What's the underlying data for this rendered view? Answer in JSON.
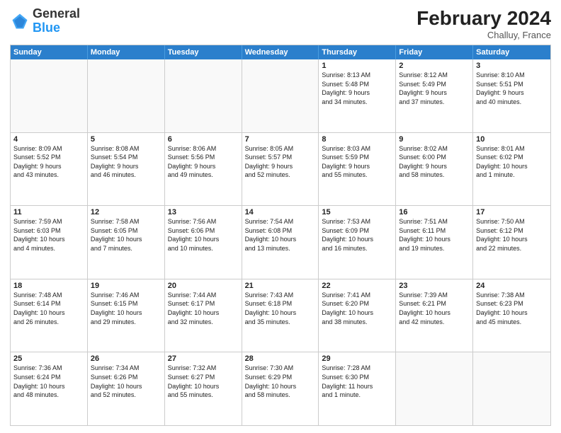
{
  "header": {
    "logo_general": "General",
    "logo_blue": "Blue",
    "month_year": "February 2024",
    "location": "Challuy, France"
  },
  "days_of_week": [
    "Sunday",
    "Monday",
    "Tuesday",
    "Wednesday",
    "Thursday",
    "Friday",
    "Saturday"
  ],
  "rows": [
    [
      {
        "day": "",
        "info": "",
        "empty": true
      },
      {
        "day": "",
        "info": "",
        "empty": true
      },
      {
        "day": "",
        "info": "",
        "empty": true
      },
      {
        "day": "",
        "info": "",
        "empty": true
      },
      {
        "day": "1",
        "info": "Sunrise: 8:13 AM\nSunset: 5:48 PM\nDaylight: 9 hours\nand 34 minutes."
      },
      {
        "day": "2",
        "info": "Sunrise: 8:12 AM\nSunset: 5:49 PM\nDaylight: 9 hours\nand 37 minutes."
      },
      {
        "day": "3",
        "info": "Sunrise: 8:10 AM\nSunset: 5:51 PM\nDaylight: 9 hours\nand 40 minutes."
      }
    ],
    [
      {
        "day": "4",
        "info": "Sunrise: 8:09 AM\nSunset: 5:52 PM\nDaylight: 9 hours\nand 43 minutes."
      },
      {
        "day": "5",
        "info": "Sunrise: 8:08 AM\nSunset: 5:54 PM\nDaylight: 9 hours\nand 46 minutes."
      },
      {
        "day": "6",
        "info": "Sunrise: 8:06 AM\nSunset: 5:56 PM\nDaylight: 9 hours\nand 49 minutes."
      },
      {
        "day": "7",
        "info": "Sunrise: 8:05 AM\nSunset: 5:57 PM\nDaylight: 9 hours\nand 52 minutes."
      },
      {
        "day": "8",
        "info": "Sunrise: 8:03 AM\nSunset: 5:59 PM\nDaylight: 9 hours\nand 55 minutes."
      },
      {
        "day": "9",
        "info": "Sunrise: 8:02 AM\nSunset: 6:00 PM\nDaylight: 9 hours\nand 58 minutes."
      },
      {
        "day": "10",
        "info": "Sunrise: 8:01 AM\nSunset: 6:02 PM\nDaylight: 10 hours\nand 1 minute."
      }
    ],
    [
      {
        "day": "11",
        "info": "Sunrise: 7:59 AM\nSunset: 6:03 PM\nDaylight: 10 hours\nand 4 minutes."
      },
      {
        "day": "12",
        "info": "Sunrise: 7:58 AM\nSunset: 6:05 PM\nDaylight: 10 hours\nand 7 minutes."
      },
      {
        "day": "13",
        "info": "Sunrise: 7:56 AM\nSunset: 6:06 PM\nDaylight: 10 hours\nand 10 minutes."
      },
      {
        "day": "14",
        "info": "Sunrise: 7:54 AM\nSunset: 6:08 PM\nDaylight: 10 hours\nand 13 minutes."
      },
      {
        "day": "15",
        "info": "Sunrise: 7:53 AM\nSunset: 6:09 PM\nDaylight: 10 hours\nand 16 minutes."
      },
      {
        "day": "16",
        "info": "Sunrise: 7:51 AM\nSunset: 6:11 PM\nDaylight: 10 hours\nand 19 minutes."
      },
      {
        "day": "17",
        "info": "Sunrise: 7:50 AM\nSunset: 6:12 PM\nDaylight: 10 hours\nand 22 minutes."
      }
    ],
    [
      {
        "day": "18",
        "info": "Sunrise: 7:48 AM\nSunset: 6:14 PM\nDaylight: 10 hours\nand 26 minutes."
      },
      {
        "day": "19",
        "info": "Sunrise: 7:46 AM\nSunset: 6:15 PM\nDaylight: 10 hours\nand 29 minutes."
      },
      {
        "day": "20",
        "info": "Sunrise: 7:44 AM\nSunset: 6:17 PM\nDaylight: 10 hours\nand 32 minutes."
      },
      {
        "day": "21",
        "info": "Sunrise: 7:43 AM\nSunset: 6:18 PM\nDaylight: 10 hours\nand 35 minutes."
      },
      {
        "day": "22",
        "info": "Sunrise: 7:41 AM\nSunset: 6:20 PM\nDaylight: 10 hours\nand 38 minutes."
      },
      {
        "day": "23",
        "info": "Sunrise: 7:39 AM\nSunset: 6:21 PM\nDaylight: 10 hours\nand 42 minutes."
      },
      {
        "day": "24",
        "info": "Sunrise: 7:38 AM\nSunset: 6:23 PM\nDaylight: 10 hours\nand 45 minutes."
      }
    ],
    [
      {
        "day": "25",
        "info": "Sunrise: 7:36 AM\nSunset: 6:24 PM\nDaylight: 10 hours\nand 48 minutes."
      },
      {
        "day": "26",
        "info": "Sunrise: 7:34 AM\nSunset: 6:26 PM\nDaylight: 10 hours\nand 52 minutes."
      },
      {
        "day": "27",
        "info": "Sunrise: 7:32 AM\nSunset: 6:27 PM\nDaylight: 10 hours\nand 55 minutes."
      },
      {
        "day": "28",
        "info": "Sunrise: 7:30 AM\nSunset: 6:29 PM\nDaylight: 10 hours\nand 58 minutes."
      },
      {
        "day": "29",
        "info": "Sunrise: 7:28 AM\nSunset: 6:30 PM\nDaylight: 11 hours\nand 1 minute."
      },
      {
        "day": "",
        "info": "",
        "empty": true
      },
      {
        "day": "",
        "info": "",
        "empty": true
      }
    ]
  ]
}
